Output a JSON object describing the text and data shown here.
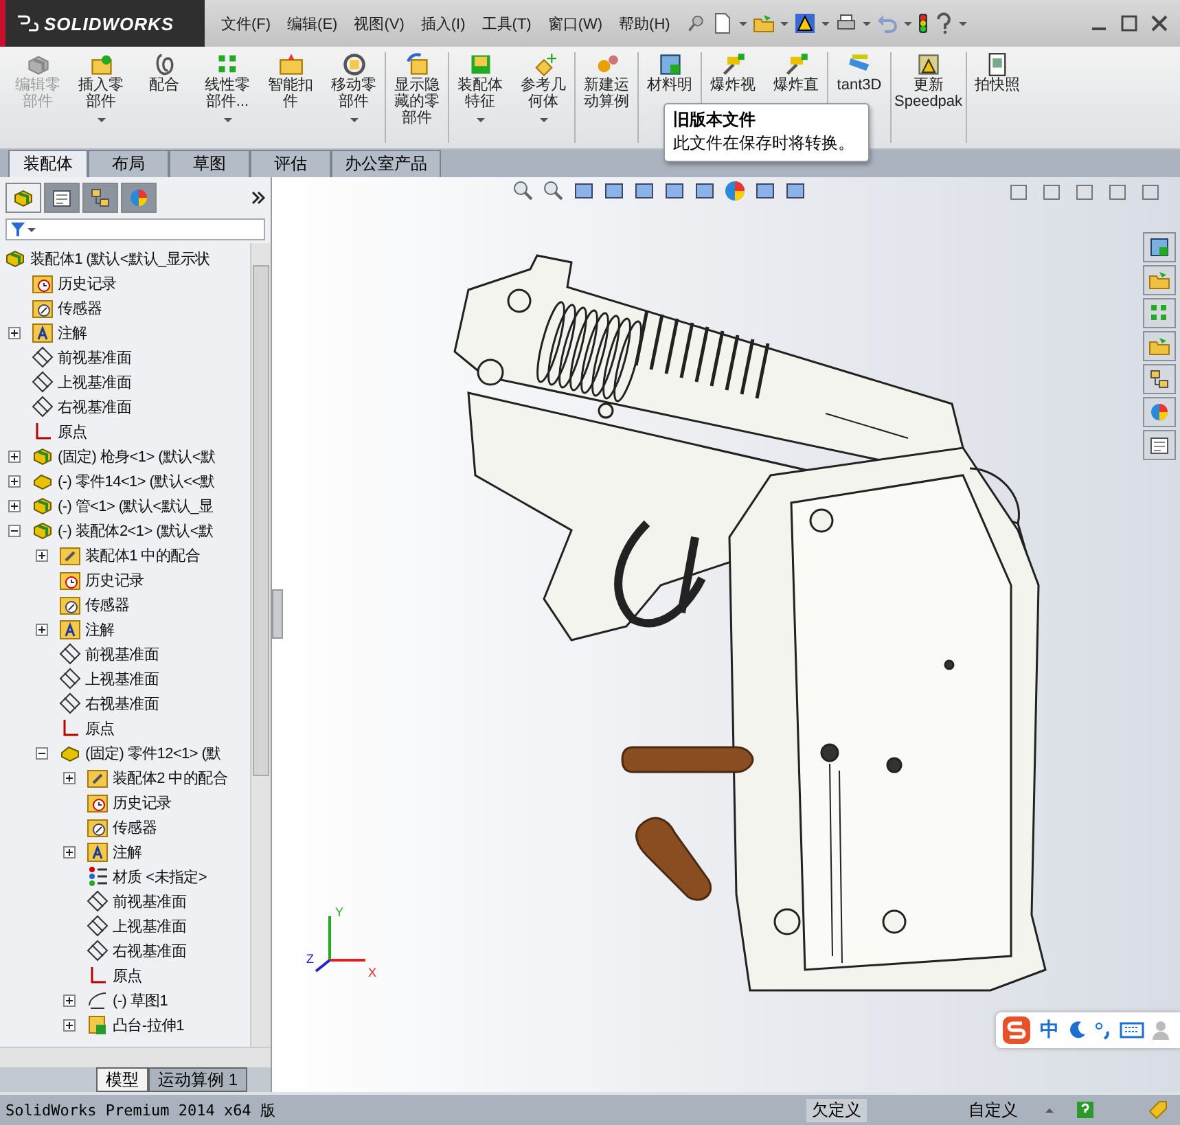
{
  "title_bar": {
    "logo": "SOLIDWORKS",
    "menu": [
      "文件(F)",
      "编辑(E)",
      "视图(V)",
      "插入(I)",
      "工具(T)",
      "窗口(W)",
      "帮助(H)"
    ],
    "quick_tools": [
      {
        "kind": "new",
        "disabled": false
      },
      {
        "kind": "open",
        "disabled": false
      },
      {
        "kind": "rebuild",
        "disabled": false
      },
      {
        "kind": "print",
        "disabled": false
      },
      {
        "kind": "undo",
        "disabled": true
      }
    ]
  },
  "command_manager": {
    "buttons": [
      {
        "lines": [
          "编辑零",
          "部件"
        ],
        "kind": "edit",
        "disabled": true,
        "dropdown": false,
        "separator": false
      },
      {
        "lines": [
          "插入零",
          "部件"
        ],
        "kind": "insert",
        "disabled": false,
        "dropdown": true,
        "separator": false
      },
      {
        "lines": [
          "配合"
        ],
        "kind": "mate",
        "disabled": false,
        "dropdown": false,
        "separator": false
      },
      {
        "lines": [
          "线性零",
          "部件..."
        ],
        "kind": "pattern",
        "disabled": false,
        "dropdown": true,
        "separator": false
      },
      {
        "lines": [
          "智能扣",
          "件"
        ],
        "kind": "fastener",
        "disabled": false,
        "dropdown": false,
        "separator": false
      },
      {
        "lines": [
          "移动零",
          "部件"
        ],
        "kind": "move",
        "disabled": false,
        "dropdown": true,
        "separator": false
      },
      {
        "lines": [
          "显示隐",
          "藏的零",
          "部件"
        ],
        "kind": "show",
        "disabled": false,
        "dropdown": false,
        "separator": true
      },
      {
        "lines": [
          "装配体",
          "特征"
        ],
        "kind": "feature",
        "disabled": false,
        "dropdown": true,
        "separator": true
      },
      {
        "lines": [
          "参考几",
          "何体"
        ],
        "kind": "reference",
        "disabled": false,
        "dropdown": true,
        "separator": false
      },
      {
        "lines": [
          "新建运",
          "动算例"
        ],
        "kind": "motion",
        "disabled": false,
        "dropdown": false,
        "separator": true
      },
      {
        "lines": [
          "材料明"
        ],
        "kind": "bom",
        "disabled": false,
        "dropdown": false,
        "separator": true
      },
      {
        "lines": [
          "爆炸视"
        ],
        "kind": "explode",
        "disabled": false,
        "dropdown": false,
        "separator": true
      },
      {
        "lines": [
          "爆炸直"
        ],
        "kind": "explode",
        "disabled": false,
        "dropdown": false,
        "separator": false
      },
      {
        "lines": [
          "tant3D"
        ],
        "kind": "instant",
        "disabled": false,
        "dropdown": false,
        "separator": true
      },
      {
        "lines": [
          "更新",
          "Speedpak"
        ],
        "kind": "speedpak",
        "disabled": false,
        "dropdown": false,
        "separator": true
      },
      {
        "lines": [
          "拍快照"
        ],
        "kind": "snapshot",
        "disabled": false,
        "dropdown": false,
        "separator": true
      }
    ],
    "tooltip": {
      "title": "旧版本文件",
      "text": "此文件在保存时将转换。"
    },
    "tabs": [
      {
        "label": "装配体",
        "selected": true
      },
      {
        "label": "布局",
        "selected": false
      },
      {
        "label": "草图",
        "selected": false
      },
      {
        "label": "评估",
        "selected": false
      },
      {
        "label": "办公室产品",
        "selected": false
      }
    ]
  },
  "panel_tabs": [
    {
      "kind": "tree",
      "selected": true
    },
    {
      "kind": "property",
      "selected": false
    },
    {
      "kind": "config",
      "selected": false
    },
    {
      "kind": "display",
      "selected": false
    }
  ],
  "tree": [
    {
      "label": "装配体1  (默认<默认_显示状",
      "kind": "assembly",
      "children": [
        {
          "label": "历史记录",
          "kind": "history"
        },
        {
          "label": "传感器",
          "kind": "sensor"
        },
        {
          "label": "注解",
          "kind": "annotation",
          "expanded": false
        },
        {
          "label": "前视基准面",
          "kind": "plane"
        },
        {
          "label": "上视基准面",
          "kind": "plane"
        },
        {
          "label": "右视基准面",
          "kind": "plane"
        },
        {
          "label": "原点",
          "kind": "origin"
        },
        {
          "label": "(固定) 枪身<1> (默认<默",
          "kind": "assembly",
          "expanded": false
        },
        {
          "label": "(-) 零件14<1> (默认<<默",
          "kind": "part",
          "expanded": false
        },
        {
          "label": "(-) 管<1> (默认<默认_显",
          "kind": "assembly",
          "expanded": false
        },
        {
          "label": "(-) 装配体2<1> (默认<默",
          "kind": "assembly",
          "expanded": true,
          "children": [
            {
              "label": "装配体1 中的配合",
              "kind": "mates",
              "expanded": false
            },
            {
              "label": "历史记录",
              "kind": "history"
            },
            {
              "label": "传感器",
              "kind": "sensor"
            },
            {
              "label": "注解",
              "kind": "annotation",
              "expanded": false
            },
            {
              "label": "前视基准面",
              "kind": "plane"
            },
            {
              "label": "上视基准面",
              "kind": "plane"
            },
            {
              "label": "右视基准面",
              "kind": "plane"
            },
            {
              "label": "原点",
              "kind": "origin"
            },
            {
              "label": "(固定) 零件12<1> (默",
              "kind": "part",
              "expanded": true,
              "children": [
                {
                  "label": "装配体2 中的配合",
                  "kind": "mates",
                  "expanded": false
                },
                {
                  "label": "历史记录",
                  "kind": "history"
                },
                {
                  "label": "传感器",
                  "kind": "sensor"
                },
                {
                  "label": "注解",
                  "kind": "annotation",
                  "expanded": false
                },
                {
                  "label": "材质 <未指定>",
                  "kind": "material"
                },
                {
                  "label": "前视基准面",
                  "kind": "plane"
                },
                {
                  "label": "上视基准面",
                  "kind": "plane"
                },
                {
                  "label": "右视基准面",
                  "kind": "plane"
                },
                {
                  "label": "原点",
                  "kind": "origin"
                },
                {
                  "label": "(-) 草图1",
                  "kind": "sketch",
                  "expanded": false
                },
                {
                  "label": "凸台-拉伸1",
                  "kind": "extrude",
                  "expanded": false
                }
              ]
            }
          ]
        }
      ]
    }
  ],
  "bottom_tabs": [
    {
      "label": "模型",
      "selected": true
    },
    {
      "label": "运动算例 1",
      "selected": false
    }
  ],
  "viewport": {
    "triad": [
      "Y",
      "X",
      "Z"
    ]
  },
  "ime_bar": {
    "mode": "中"
  },
  "status_bar": {
    "product": "SolidWorks Premium 2014 x64 版",
    "state": "欠定义",
    "units": "自定义"
  }
}
